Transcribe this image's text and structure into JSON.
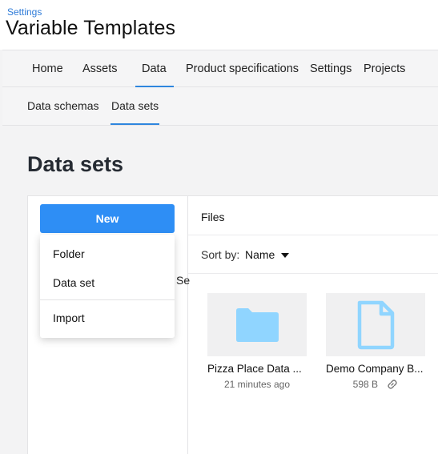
{
  "header": {
    "breadcrumb": "Settings",
    "title": "Variable Templates"
  },
  "topnav": {
    "tabs": [
      {
        "label": "Home"
      },
      {
        "label": "Assets"
      },
      {
        "label": "Data",
        "active": true
      },
      {
        "label": "Product specifications"
      },
      {
        "label": "Settings"
      },
      {
        "label": "Projects"
      }
    ]
  },
  "subnav": {
    "tabs": [
      {
        "label": "Data schemas"
      },
      {
        "label": "Data sets",
        "active": true
      }
    ]
  },
  "page": {
    "title": "Data sets",
    "new_button": "New",
    "menu": {
      "items": [
        "Folder",
        "Data set",
        "Import"
      ]
    },
    "obscured_text": "Se"
  },
  "files": {
    "title": "Files",
    "sort_label": "Sort by:",
    "sort_value": "Name",
    "items": [
      {
        "name": "Pizza Place Data ...",
        "meta": "21 minutes ago",
        "icon": "folder-icon"
      },
      {
        "name": "Demo Company B...",
        "meta": "598 B",
        "icon": "file-icon",
        "linked": true
      }
    ]
  },
  "colors": {
    "accent": "#2e86de",
    "button": "#2e8ef5",
    "icon": "#90d5ff"
  }
}
